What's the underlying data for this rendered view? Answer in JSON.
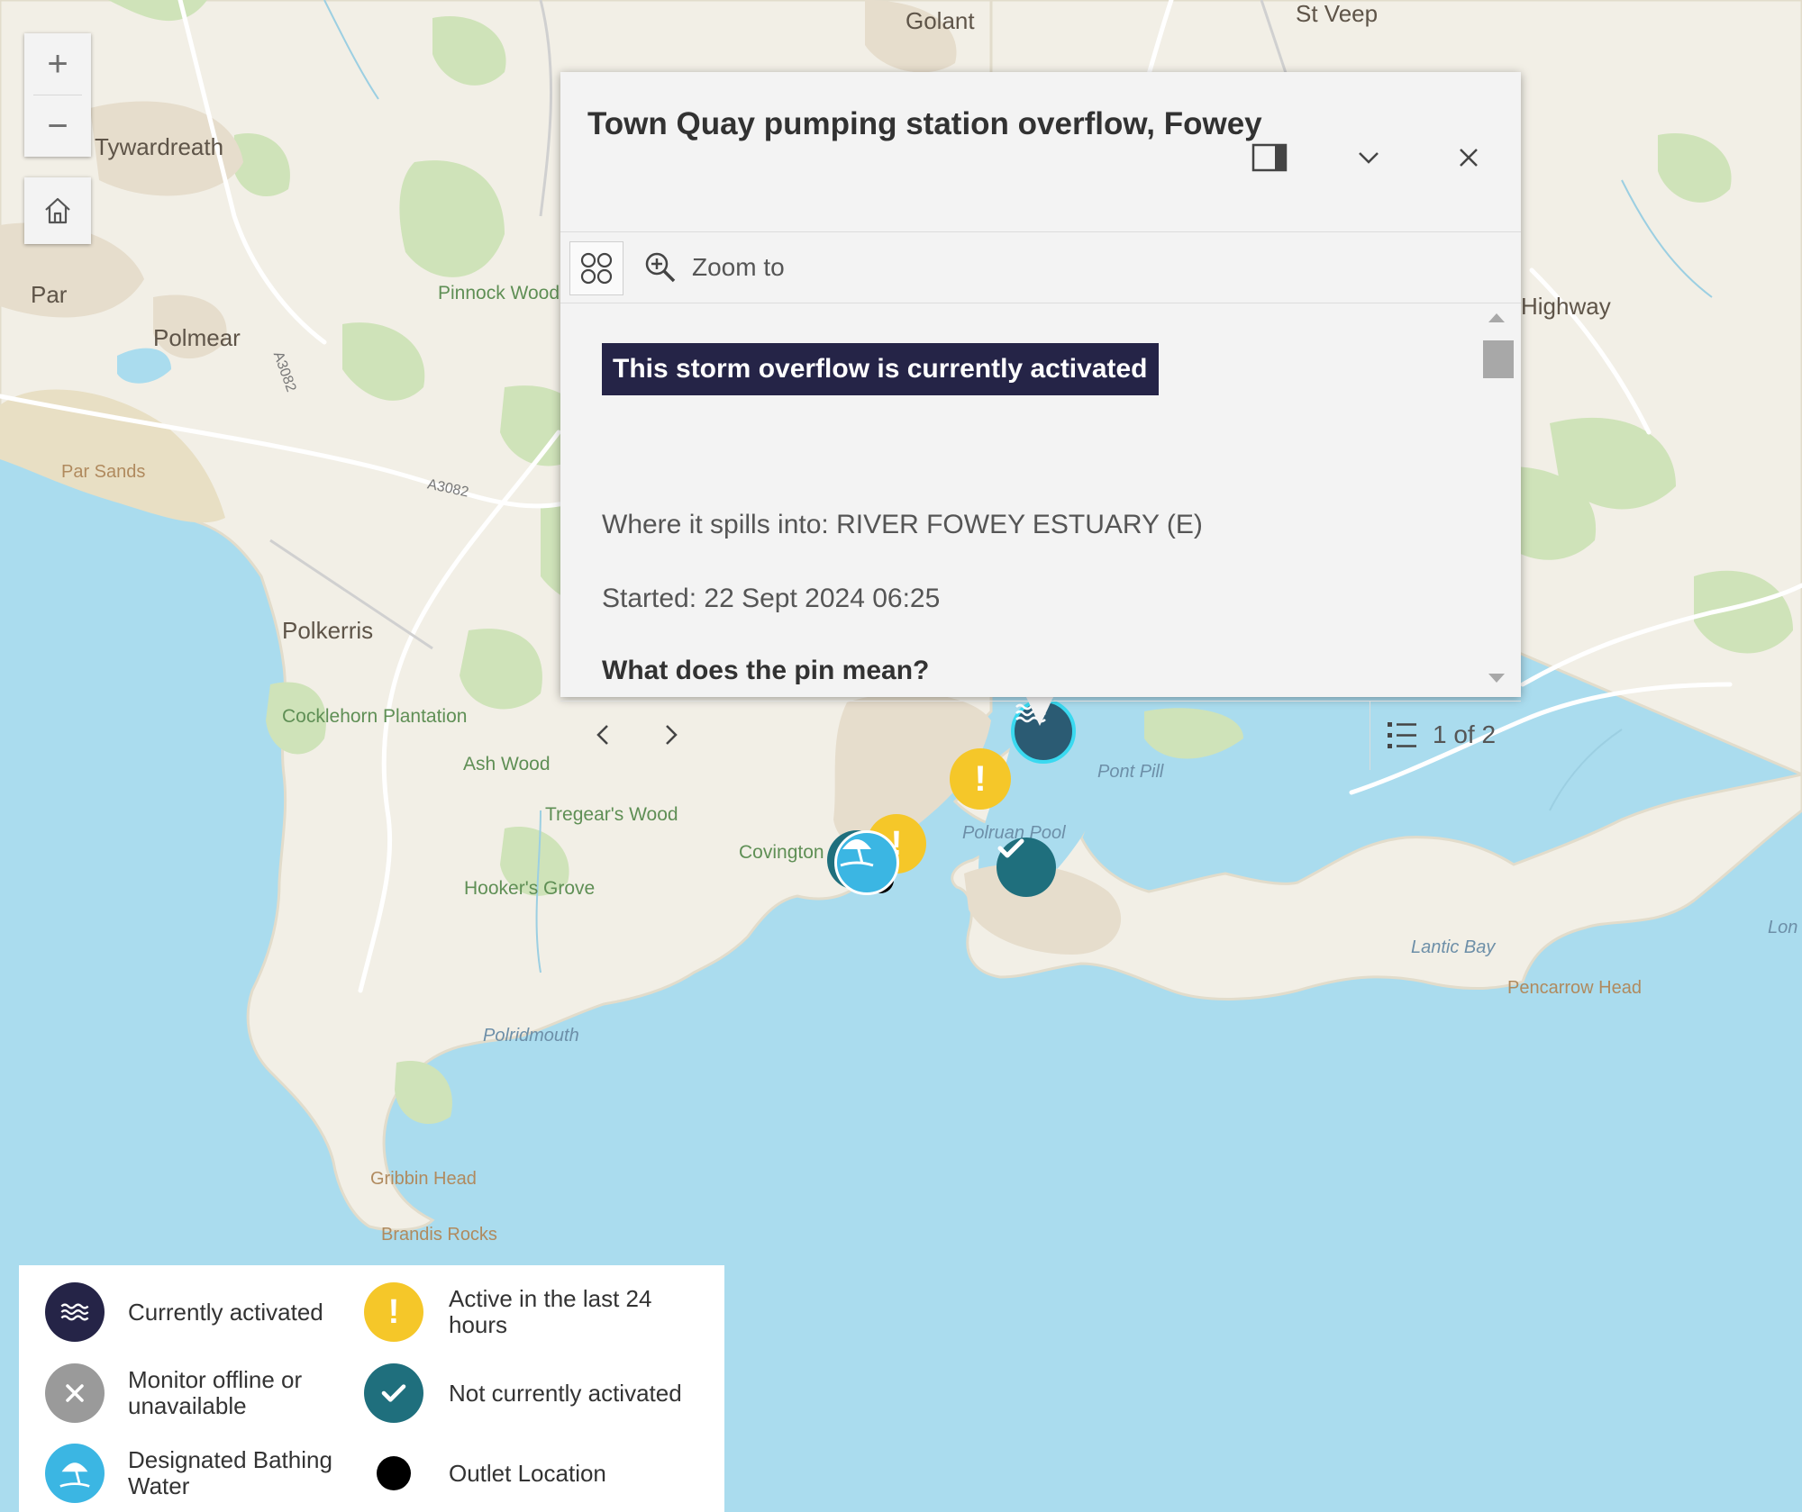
{
  "map": {
    "places": [
      {
        "name": "Golant",
        "cls": "town"
      },
      {
        "name": "St Veep",
        "cls": "town"
      },
      {
        "name": "Tywardreath",
        "cls": "town"
      },
      {
        "name": "Par",
        "cls": "town"
      },
      {
        "name": "Polmear",
        "cls": "town"
      },
      {
        "name": "Pinnock Wood",
        "cls": "wood"
      },
      {
        "name": "Par Sands",
        "cls": "coast"
      },
      {
        "name": "A3082",
        "cls": "road"
      },
      {
        "name": "A3082",
        "cls": "road"
      },
      {
        "name": "Polkerris",
        "cls": "town"
      },
      {
        "name": "Cocklehorn Plantation",
        "cls": "wood"
      },
      {
        "name": "Ash Wood",
        "cls": "wood"
      },
      {
        "name": "Tregear's Wood",
        "cls": "wood"
      },
      {
        "name": "Covington",
        "cls": "wood"
      },
      {
        "name": "Hooker's Grove",
        "cls": "wood"
      },
      {
        "name": "Polridmouth",
        "cls": "water"
      },
      {
        "name": "Gribbin Head",
        "cls": "coast"
      },
      {
        "name": "Brandis Rocks",
        "cls": "coast"
      },
      {
        "name": "Pont Pill",
        "cls": "water"
      },
      {
        "name": "Polruan Pool",
        "cls": "water"
      },
      {
        "name": "Lantic Bay",
        "cls": "water"
      },
      {
        "name": "Pencarrow Head",
        "cls": "coast"
      },
      {
        "name": "Highway",
        "cls": "town"
      },
      {
        "name": "Lon",
        "cls": "water"
      }
    ]
  },
  "controls": {
    "zoom_in": "+",
    "zoom_out": "−"
  },
  "popup": {
    "title": "Town Quay pumping station overflow, Fowey",
    "zoom_to": "Zoom to",
    "status_badge": "This storm overflow is currently activated",
    "spills_into": "Where it spills into: RIVER FOWEY ESTUARY (E)",
    "started": "Started: 22 Sept 2024 06:25",
    "question": "What does the pin mean?",
    "pagination": "1 of 2"
  },
  "legend": {
    "items": [
      {
        "label": "Currently activated",
        "icon": "waves-icon",
        "color": "#252447"
      },
      {
        "label": "Active in the last 24 hours",
        "icon": "exclamation-icon",
        "color": "#f5c729"
      },
      {
        "label": "Monitor offline or unavailable",
        "icon": "x-icon",
        "color": "#9a9a9a"
      },
      {
        "label": "Not currently activated",
        "icon": "check-icon",
        "color": "#1f6f7d"
      },
      {
        "label": "Designated Bathing Water",
        "icon": "beach-umbrella-icon",
        "color": "#3bb6e3"
      },
      {
        "label": "Outlet Location",
        "icon": "dot-icon",
        "color": "#000000"
      }
    ]
  },
  "colors": {
    "sea": "#aadcee",
    "land": "#f2efe6",
    "woodland": "#cfe3b9",
    "activated": "#252447",
    "recent": "#f5c729",
    "not_activated": "#1f6f7d",
    "bathing": "#3bb6e3"
  }
}
